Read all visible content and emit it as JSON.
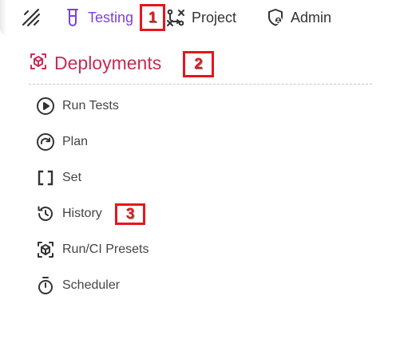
{
  "topbar": {
    "logo_icon": "pen-logo-icon",
    "nav": [
      {
        "label": "Testing",
        "icon": "test-tube-icon",
        "active": true,
        "color": "#7b3fe4"
      },
      {
        "label": "Project",
        "icon": "git-branch-icon"
      },
      {
        "label": "Admin",
        "icon": "shield-user-icon"
      }
    ]
  },
  "section": {
    "title": "Deployments",
    "icon": "cube-scan-icon",
    "color": "#c42d52"
  },
  "menu": [
    {
      "label": "Run Tests",
      "icon": "play-circle-icon"
    },
    {
      "label": "Plan",
      "icon": "redo-circle-icon"
    },
    {
      "label": "Set",
      "icon": "brackets-icon"
    },
    {
      "label": "History",
      "icon": "history-icon"
    },
    {
      "label": "Run/CI Presets",
      "icon": "cube-scan-icon"
    },
    {
      "label": "Scheduler",
      "icon": "stopwatch-icon"
    }
  ],
  "annotations": [
    {
      "number": "1",
      "color": "#e8141c"
    },
    {
      "number": "2",
      "color": "#e8141c"
    },
    {
      "number": "3",
      "color": "#e8141c"
    }
  ]
}
